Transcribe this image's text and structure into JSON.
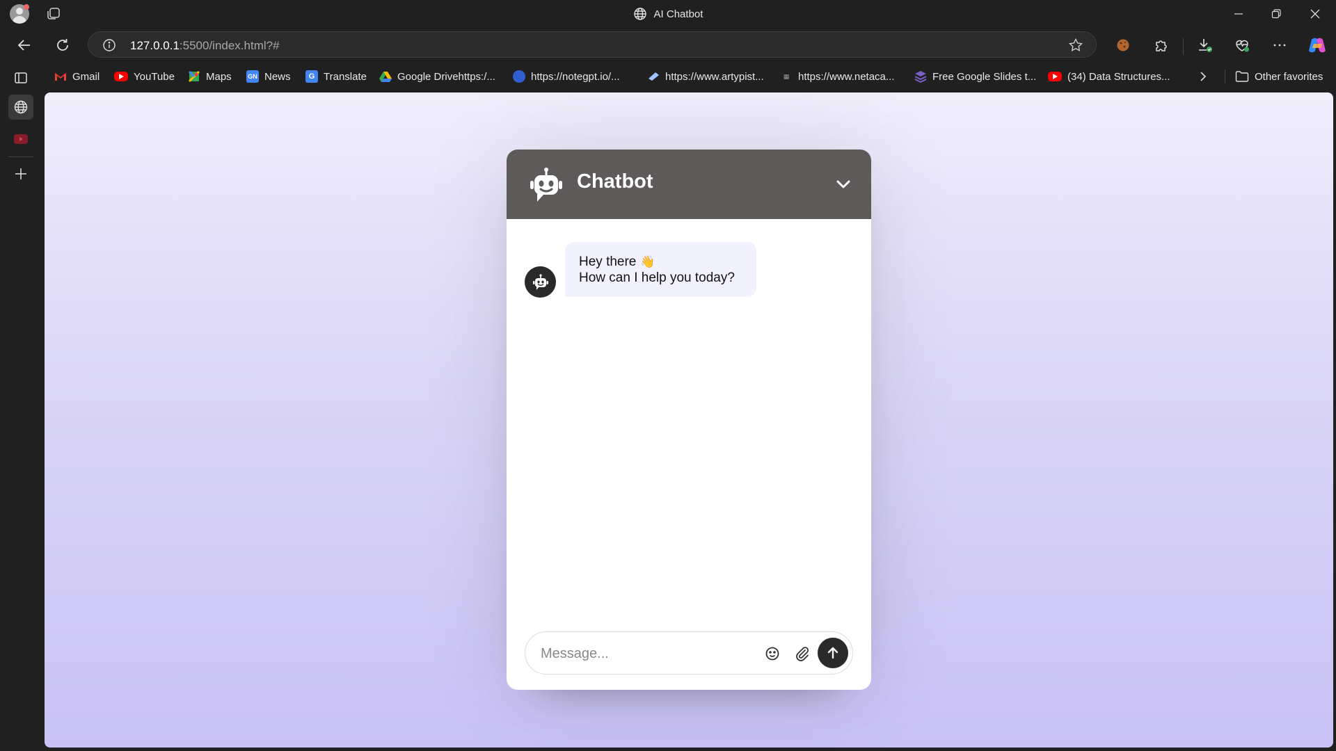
{
  "window": {
    "title": "AI Chatbot"
  },
  "addressbar": {
    "url_host": "127.0.0.1",
    "url_rest": ":5500/index.html?#"
  },
  "favorites": [
    {
      "label": "Gmail",
      "icon": "gmail-icon",
      "color": "#ea4335"
    },
    {
      "label": "YouTube",
      "icon": "youtube-icon",
      "color": "#ff0000"
    },
    {
      "label": "Maps",
      "icon": "maps-icon",
      "color": "#34a853"
    },
    {
      "label": "News",
      "icon": "news-icon",
      "color": "#4285f4"
    },
    {
      "label": "Translate",
      "icon": "translate-icon",
      "color": "#4285f4"
    },
    {
      "label": "Google Drivehttps:/...",
      "icon": "drive-icon",
      "color": "#fbbc04"
    },
    {
      "label": "https://notegpt.io/...",
      "icon": "notegpt-icon",
      "color": "#2f5fd0"
    },
    {
      "label": "https://www.artypist...",
      "icon": "artypist-icon",
      "color": "#9ec3ff"
    },
    {
      "label": "https://www.netaca...",
      "icon": "netaca-icon",
      "color": "#777777"
    },
    {
      "label": "Free Google Slides t...",
      "icon": "slides-icon",
      "color": "#7b5fc7"
    },
    {
      "label": "(34) Data Structures...",
      "icon": "youtube-icon",
      "color": "#ff0000"
    }
  ],
  "other_favorites": "Other favorites",
  "chat": {
    "title": "Chatbot",
    "message_line1": "Hey there",
    "wave_emoji": "👋",
    "message_line2": "How can I help you today?",
    "input_placeholder": "Message...",
    "header_color": "#5e5a5a",
    "bubble_color": "#f2f1fe"
  }
}
